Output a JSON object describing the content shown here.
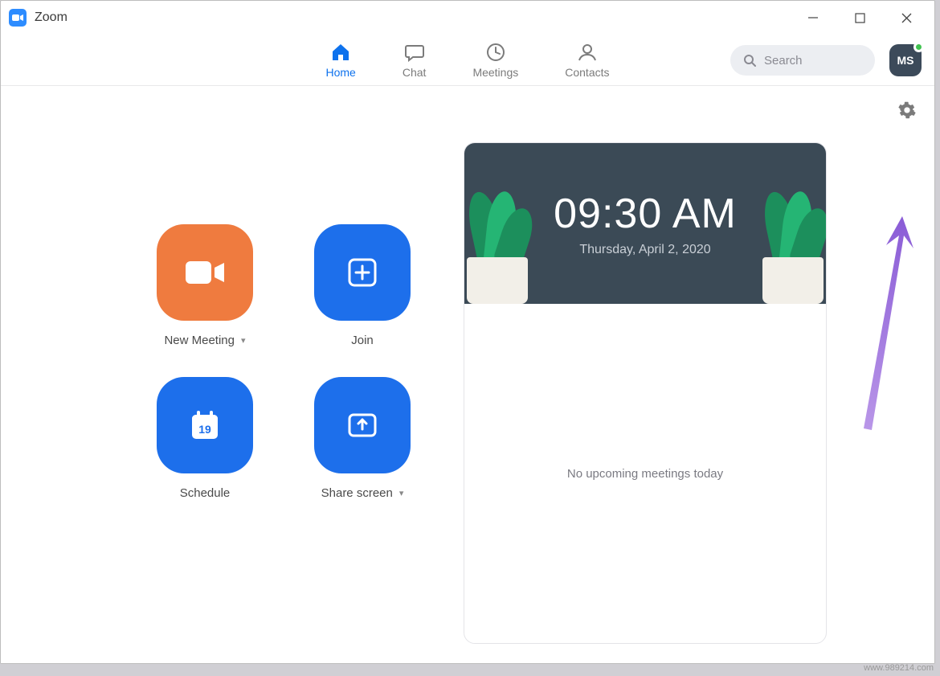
{
  "window": {
    "title": "Zoom",
    "minimize": "—",
    "maximize": "▢",
    "close": "✕"
  },
  "tabs": {
    "home": "Home",
    "chat": "Chat",
    "meetings": "Meetings",
    "contacts": "Contacts"
  },
  "search": {
    "placeholder": "Search"
  },
  "avatar": {
    "initials": "MS"
  },
  "tiles": {
    "new_meeting": "New Meeting",
    "join": "Join",
    "schedule": "Schedule",
    "schedule_day": "19",
    "share_screen": "Share screen"
  },
  "calendar": {
    "time": "09:30 AM",
    "date": "Thursday, April 2, 2020",
    "empty_message": "No upcoming meetings today"
  },
  "watermark": "www.989214.com"
}
